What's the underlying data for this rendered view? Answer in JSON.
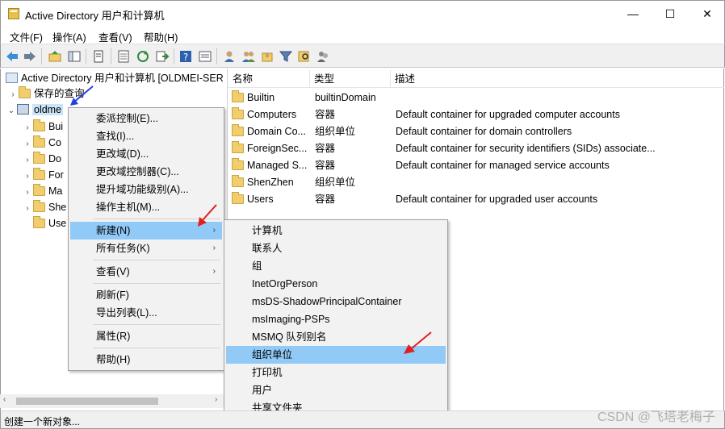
{
  "window": {
    "title": "Active Directory 用户和计算机",
    "minimize": "—",
    "maximize": "☐",
    "close": "✕"
  },
  "menubar": {
    "items": [
      "文件(F)",
      "操作(A)",
      "查看(V)",
      "帮助(H)"
    ]
  },
  "toolbar": {
    "buttons": [
      "back-icon",
      "forward-icon",
      "folder-up-icon",
      "show-tree-icon",
      "copy-icon",
      "properties-icon",
      "refresh-icon",
      "export-icon",
      "help-icon",
      "details-icon",
      "user-icon",
      "group-icon",
      "add-group-icon",
      "filter-icon",
      "find-icon",
      "users-group-icon"
    ]
  },
  "tree": {
    "root": "Active Directory 用户和计算机 [OLDMEI-SER",
    "saved_queries": "保存的查询",
    "domain": "oldme",
    "children": [
      "Bui",
      "Co",
      "Do",
      "For",
      "Ma",
      "She",
      "Use"
    ]
  },
  "list": {
    "headers": [
      "名称",
      "类型",
      "描述"
    ],
    "rows": [
      {
        "name": "Builtin",
        "type": "builtinDomain",
        "desc": ""
      },
      {
        "name": "Computers",
        "type": "容器",
        "desc": "Default container for upgraded computer accounts"
      },
      {
        "name": "Domain Co...",
        "type": "组织单位",
        "desc": "Default container for domain controllers"
      },
      {
        "name": "ForeignSec...",
        "type": "容器",
        "desc": "Default container for security identifiers (SIDs) associate..."
      },
      {
        "name": "Managed S...",
        "type": "容器",
        "desc": "Default container for managed service accounts"
      },
      {
        "name": "ShenZhen",
        "type": "组织单位",
        "desc": ""
      },
      {
        "name": "Users",
        "type": "容器",
        "desc": "Default container for upgraded user accounts"
      }
    ]
  },
  "context_menu": {
    "items": [
      "委派控制(E)...",
      "查找(I)...",
      "更改域(D)...",
      "更改域控制器(C)...",
      "提升域功能级别(A)...",
      "操作主机(M)...",
      "新建(N)",
      "所有任务(K)",
      "查看(V)",
      "刷新(F)",
      "导出列表(L)...",
      "属性(R)",
      "帮助(H)"
    ],
    "highlighted": "新建(N)"
  },
  "submenu": {
    "items": [
      "计算机",
      "联系人",
      "组",
      "InetOrgPerson",
      "msDS-ShadowPrincipalContainer",
      "msImaging-PSPs",
      "MSMQ 队列别名",
      "组织单位",
      "打印机",
      "用户",
      "共享文件夹"
    ],
    "highlighted": "组织单位"
  },
  "status": "创建一个新对象...",
  "watermark": "CSDN @飞塔老梅子",
  "colors": {
    "highlight": "#91c9f7",
    "arrow_red": "#e02020",
    "arrow_blue": "#2040e0"
  }
}
